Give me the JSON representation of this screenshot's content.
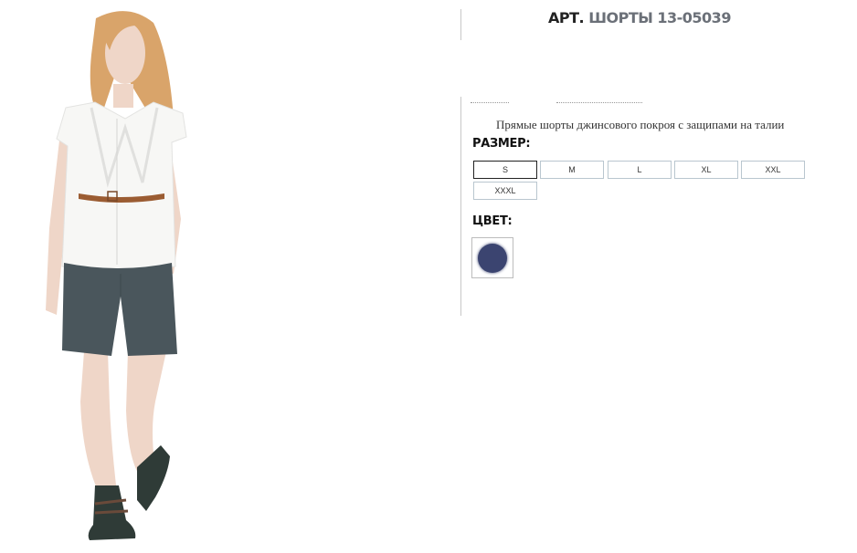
{
  "product": {
    "title_prefix": "АРТ.",
    "title_main": "ШОРТЫ 13-05039",
    "description": "Прямые шорты джинсового покроя с защипами на талии"
  },
  "sizes": {
    "label": "РАЗМЕР:",
    "options": [
      "S",
      "M",
      "L",
      "XL",
      "XXL",
      "XXXL"
    ],
    "selected": "S"
  },
  "colors": {
    "label": "ЦВЕТ:",
    "swatches": [
      {
        "hex": "#3b4470"
      }
    ]
  },
  "photo": {
    "shirt_color": "#f7f7f5",
    "shorts_color": "#4a565c",
    "skin_color": "#efd6c8",
    "hair_color": "#d9a46a",
    "belt_color": "#9b5c32",
    "boot_color": "#2f3b37"
  }
}
